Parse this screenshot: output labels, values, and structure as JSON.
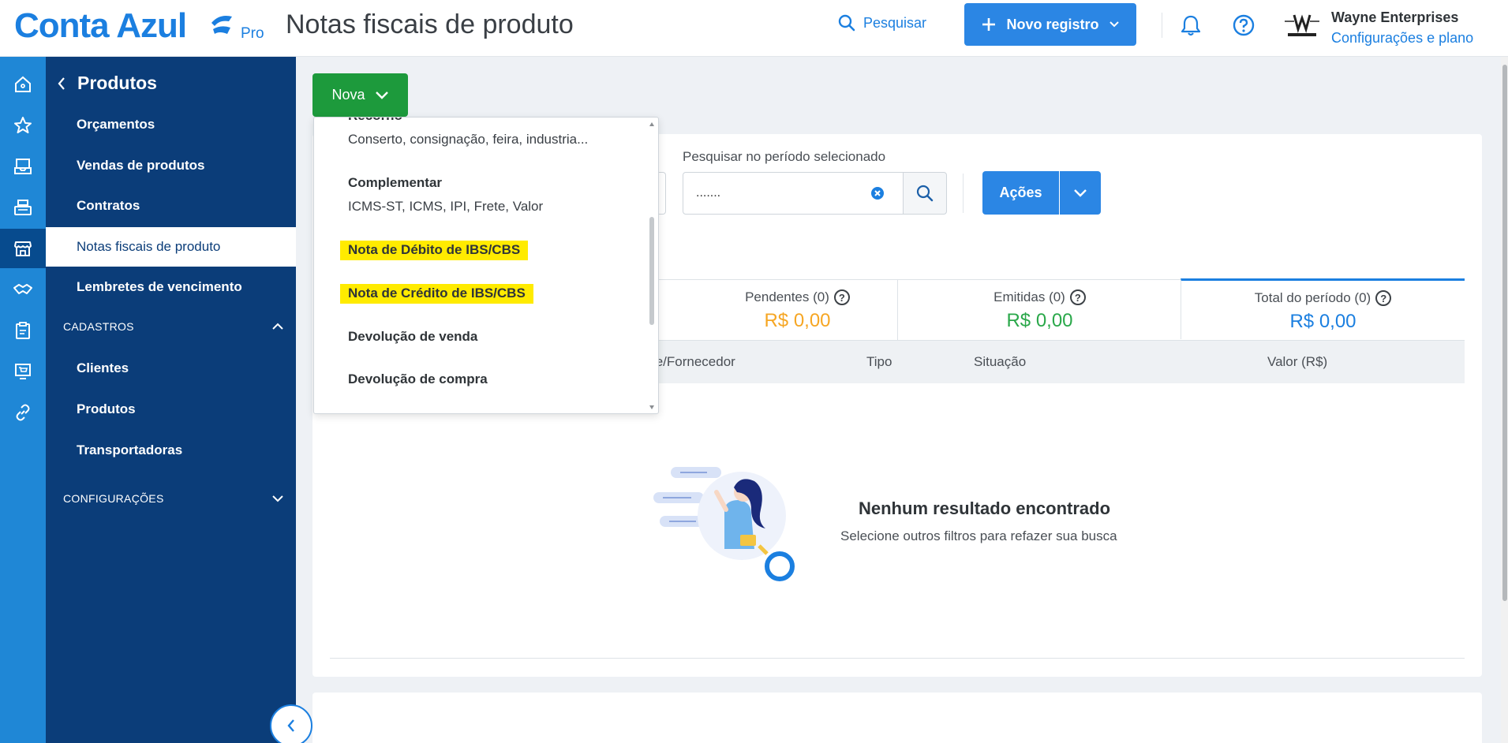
{
  "header": {
    "brand": "Conta Azul",
    "plan_badge": "Pro",
    "page_title": "Notas fiscais de produto",
    "search_label": "Pesquisar",
    "new_record_label": "Novo registro",
    "company_name": "Wayne Enterprises",
    "company_link": "Configurações e plano"
  },
  "rail": {
    "icons": [
      "home-icon",
      "star-icon",
      "inbox-icon",
      "cash-register-icon",
      "store-icon",
      "handshake-icon",
      "clipboard-icon",
      "monitor-cart-icon",
      "link-icon"
    ],
    "active_index": 4
  },
  "sidebar": {
    "back_title": "Produtos",
    "items": [
      {
        "label": "Orçamentos"
      },
      {
        "label": "Vendas de produtos"
      },
      {
        "label": "Contratos"
      },
      {
        "label": "Notas fiscais de produto",
        "active": true
      },
      {
        "label": "Lembretes de vencimento"
      }
    ],
    "section_cadastros": "CADASTROS",
    "cadastros_items": [
      {
        "label": "Clientes"
      },
      {
        "label": "Produtos"
      },
      {
        "label": "Transportadoras"
      }
    ],
    "section_config": "CONFIGURAÇÕES"
  },
  "toolbar": {
    "nova_label": "Nova",
    "period_label": "Pesquisar no período selecionado",
    "period_value": ".......",
    "acoes_label": "Ações"
  },
  "dropdown": {
    "items": [
      {
        "title": "Recorno",
        "desc": "Conserto, consignação, feira, industria..."
      },
      {
        "title": "Complementar",
        "desc": "ICMS-ST, ICMS, IPI, Frete, Valor"
      },
      {
        "title": "Nota de Débito de IBS/CBS",
        "highlighted": true
      },
      {
        "title": "Nota de Crédito de IBS/CBS",
        "highlighted": true
      },
      {
        "title": "Devolução de venda"
      },
      {
        "title": "Devolução de compra"
      }
    ]
  },
  "summary": {
    "pendentes_label": "Pendentes (0)",
    "pendentes_value": "R$ 0,00",
    "emitidas_label": "Emitidas (0)",
    "emitidas_value": "R$ 0,00",
    "total_label": "Total do período (0)",
    "total_value": "R$ 0,00",
    "colors": {
      "pendentes": "#f6a623",
      "emitidas": "#2aa84a",
      "total": "#1b7fe0"
    }
  },
  "table": {
    "columns": [
      "te/Fornecedor",
      "Tipo",
      "Situação",
      "Valor (R$)"
    ]
  },
  "empty_state": {
    "title": "Nenhum resultado encontrado",
    "subtitle": "Selecione outros filtros para refazer sua busca"
  },
  "colors": {
    "brand": "#1b7fe0",
    "sidebar": "#0b3d79",
    "rail": "#1f87d6",
    "nova_button": "#1d9a3c",
    "highlight": "#ffeb00"
  }
}
